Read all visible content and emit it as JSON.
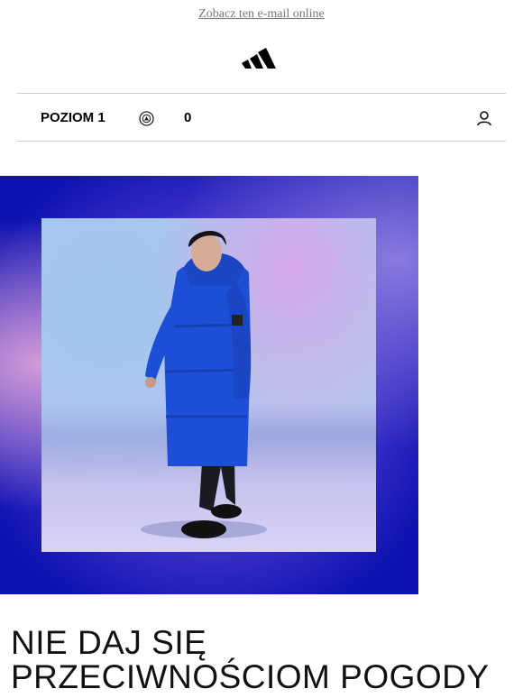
{
  "header": {
    "view_online_link": "Zobacz ten e-mail online",
    "logo_icon": "adidas-logo-icon"
  },
  "member_bar": {
    "level_label": "POZIOM 1",
    "points_icon": "points-badge-icon",
    "points_value": "0",
    "profile_icon": "profile-icon"
  },
  "hero": {
    "image_description_icon": "hero-photo",
    "accent_colors": [
      "#0e12b0",
      "#7b63d8",
      "#d39bd8",
      "#1f4fd8"
    ]
  },
  "headline": {
    "line1": "NIE DAJ SIĘ",
    "line2": "PRZECIWNOŚCIOM POGODY"
  }
}
